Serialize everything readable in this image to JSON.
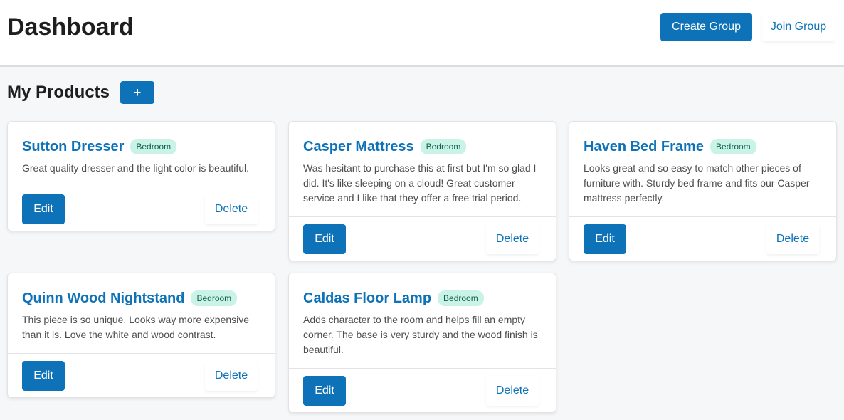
{
  "header": {
    "title": "Dashboard",
    "create_group_label": "Create Group",
    "join_group_label": "Join Group"
  },
  "section": {
    "title": "My Products",
    "add_label": "+"
  },
  "products": [
    {
      "name": "Sutton Dresser",
      "tag": "Bedroom",
      "description": "Great quality dresser and the light color is beautiful.",
      "edit_label": "Edit",
      "delete_label": "Delete"
    },
    {
      "name": "Casper Mattress",
      "tag": "Bedroom",
      "description": "Was hesitant to purchase this at first but I'm so glad I did. It's like sleeping on a cloud! Great customer service and I like that they offer a free trial period.",
      "edit_label": "Edit",
      "delete_label": "Delete"
    },
    {
      "name": "Haven Bed Frame",
      "tag": "Bedroom",
      "description": "Looks great and so easy to match other pieces of furniture with. Sturdy bed frame and fits our Casper mattress perfectly.",
      "edit_label": "Edit",
      "delete_label": "Delete"
    },
    {
      "name": "Quinn Wood Nightstand",
      "tag": "Bedroom",
      "description": "This piece is so unique. Looks way more expensive than it is. Love the white and wood contrast.",
      "edit_label": "Edit",
      "delete_label": "Delete"
    },
    {
      "name": "Caldas Floor Lamp",
      "tag": "Bedroom",
      "description": "Adds character to the room and helps fill an empty corner. The base is very sturdy and the wood finish is beautiful.",
      "edit_label": "Edit",
      "delete_label": "Delete"
    }
  ],
  "colors": {
    "accent": "#0d72b8",
    "tag_bg": "#c8f3e6",
    "tag_text": "#16604b"
  }
}
